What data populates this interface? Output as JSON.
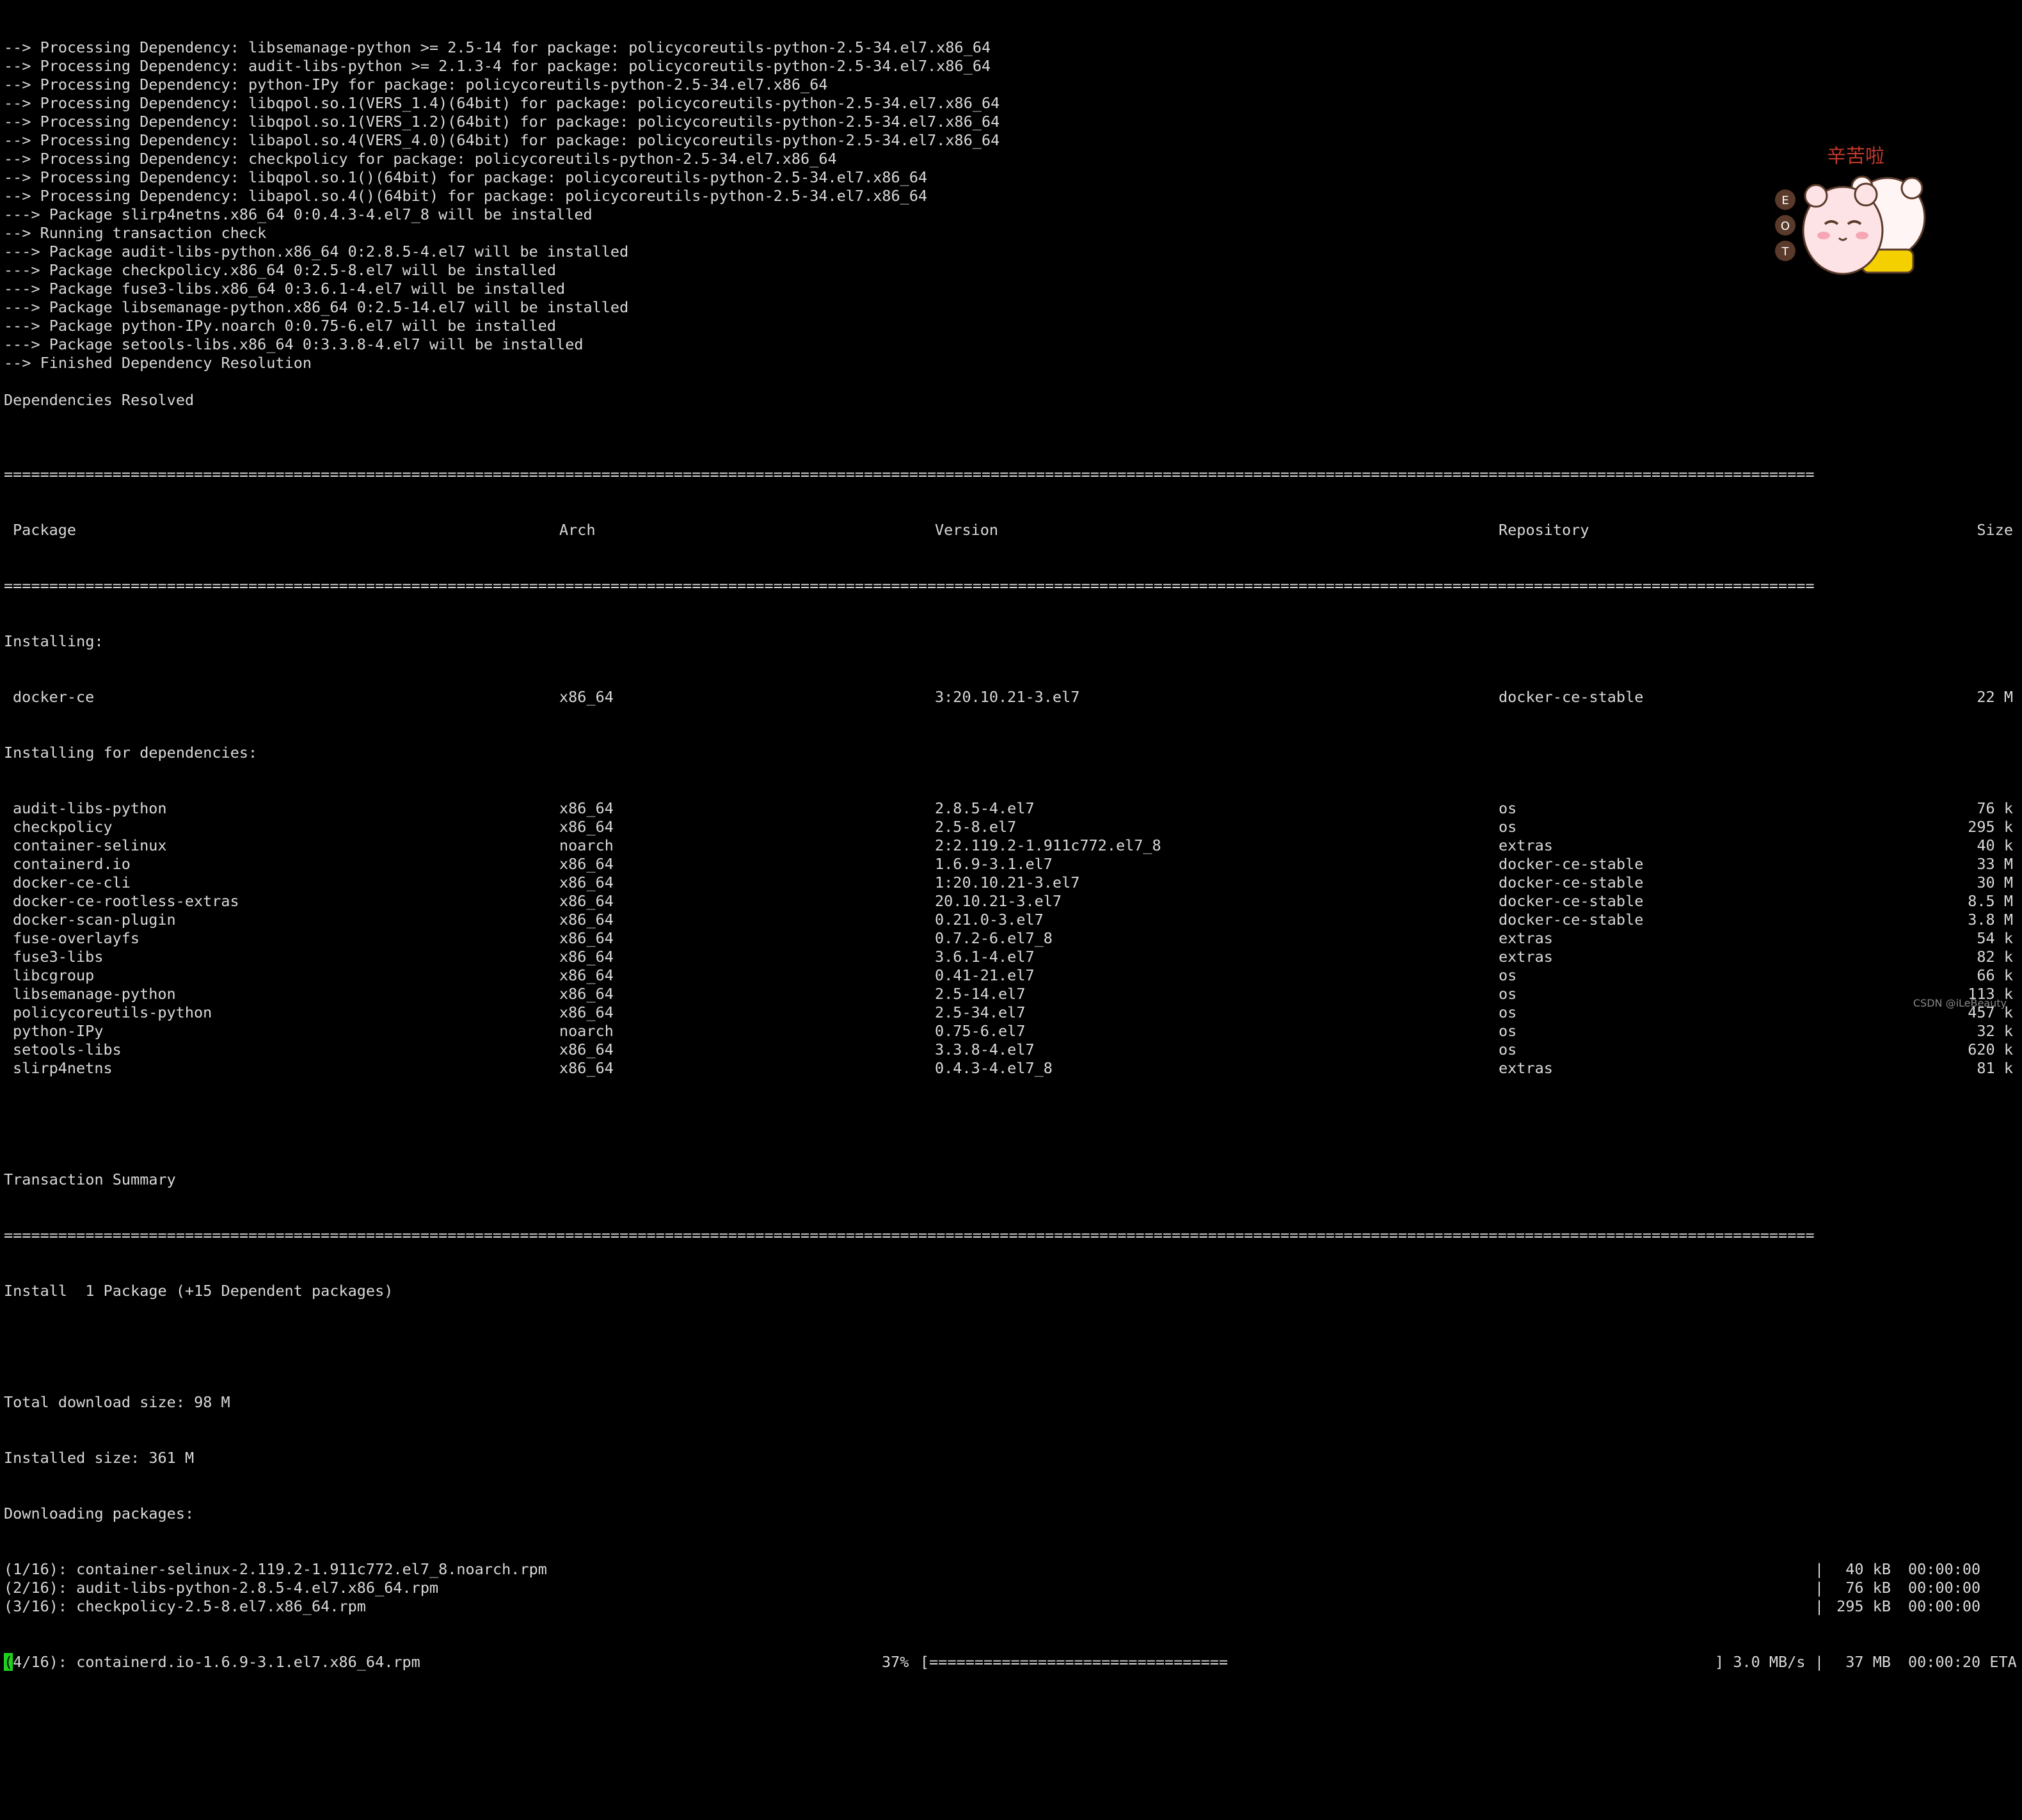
{
  "log_lines": [
    "--> Processing Dependency: libsemanage-python >= 2.5-14 for package: policycoreutils-python-2.5-34.el7.x86_64",
    "--> Processing Dependency: audit-libs-python >= 2.1.3-4 for package: policycoreutils-python-2.5-34.el7.x86_64",
    "--> Processing Dependency: python-IPy for package: policycoreutils-python-2.5-34.el7.x86_64",
    "--> Processing Dependency: libqpol.so.1(VERS_1.4)(64bit) for package: policycoreutils-python-2.5-34.el7.x86_64",
    "--> Processing Dependency: libqpol.so.1(VERS_1.2)(64bit) for package: policycoreutils-python-2.5-34.el7.x86_64",
    "--> Processing Dependency: libapol.so.4(VERS_4.0)(64bit) for package: policycoreutils-python-2.5-34.el7.x86_64",
    "--> Processing Dependency: checkpolicy for package: policycoreutils-python-2.5-34.el7.x86_64",
    "--> Processing Dependency: libqpol.so.1()(64bit) for package: policycoreutils-python-2.5-34.el7.x86_64",
    "--> Processing Dependency: libapol.so.4()(64bit) for package: policycoreutils-python-2.5-34.el7.x86_64",
    "---> Package slirp4netns.x86_64 0:0.4.3-4.el7_8 will be installed",
    "--> Running transaction check",
    "---> Package audit-libs-python.x86_64 0:2.8.5-4.el7 will be installed",
    "---> Package checkpolicy.x86_64 0:2.5-8.el7 will be installed",
    "---> Package fuse3-libs.x86_64 0:3.6.1-4.el7 will be installed",
    "---> Package libsemanage-python.x86_64 0:2.5-14.el7 will be installed",
    "---> Package python-IPy.noarch 0:0.75-6.el7 will be installed",
    "---> Package setools-libs.x86_64 0:3.3.8-4.el7 will be installed",
    "--> Finished Dependency Resolution",
    "",
    "Dependencies Resolved",
    ""
  ],
  "rule_char": "=",
  "table": {
    "headers": {
      "package": "Package",
      "arch": "Arch",
      "version": "Version",
      "repository": "Repository",
      "size": "Size"
    },
    "installing_label": "Installing:",
    "installing": [
      {
        "package": "docker-ce",
        "arch": "x86_64",
        "version": "3:20.10.21-3.el7",
        "repository": "docker-ce-stable",
        "size": "22 M"
      }
    ],
    "deps_label": "Installing for dependencies:",
    "deps": [
      {
        "package": "audit-libs-python",
        "arch": "x86_64",
        "version": "2.8.5-4.el7",
        "repository": "os",
        "size": "76 k"
      },
      {
        "package": "checkpolicy",
        "arch": "x86_64",
        "version": "2.5-8.el7",
        "repository": "os",
        "size": "295 k"
      },
      {
        "package": "container-selinux",
        "arch": "noarch",
        "version": "2:2.119.2-1.911c772.el7_8",
        "repository": "extras",
        "size": "40 k"
      },
      {
        "package": "containerd.io",
        "arch": "x86_64",
        "version": "1.6.9-3.1.el7",
        "repository": "docker-ce-stable",
        "size": "33 M"
      },
      {
        "package": "docker-ce-cli",
        "arch": "x86_64",
        "version": "1:20.10.21-3.el7",
        "repository": "docker-ce-stable",
        "size": "30 M"
      },
      {
        "package": "docker-ce-rootless-extras",
        "arch": "x86_64",
        "version": "20.10.21-3.el7",
        "repository": "docker-ce-stable",
        "size": "8.5 M"
      },
      {
        "package": "docker-scan-plugin",
        "arch": "x86_64",
        "version": "0.21.0-3.el7",
        "repository": "docker-ce-stable",
        "size": "3.8 M"
      },
      {
        "package": "fuse-overlayfs",
        "arch": "x86_64",
        "version": "0.7.2-6.el7_8",
        "repository": "extras",
        "size": "54 k"
      },
      {
        "package": "fuse3-libs",
        "arch": "x86_64",
        "version": "3.6.1-4.el7",
        "repository": "extras",
        "size": "82 k"
      },
      {
        "package": "libcgroup",
        "arch": "x86_64",
        "version": "0.41-21.el7",
        "repository": "os",
        "size": "66 k"
      },
      {
        "package": "libsemanage-python",
        "arch": "x86_64",
        "version": "2.5-14.el7",
        "repository": "os",
        "size": "113 k"
      },
      {
        "package": "policycoreutils-python",
        "arch": "x86_64",
        "version": "2.5-34.el7",
        "repository": "os",
        "size": "457 k"
      },
      {
        "package": "python-IPy",
        "arch": "noarch",
        "version": "0.75-6.el7",
        "repository": "os",
        "size": "32 k"
      },
      {
        "package": "setools-libs",
        "arch": "x86_64",
        "version": "3.3.8-4.el7",
        "repository": "os",
        "size": "620 k"
      },
      {
        "package": "slirp4netns",
        "arch": "x86_64",
        "version": "0.4.3-4.el7_8",
        "repository": "extras",
        "size": "81 k"
      }
    ]
  },
  "summary": {
    "title": "Transaction Summary",
    "install_line": "Install  1 Package (+15 Dependent packages)",
    "total_download": "Total download size: 98 M",
    "installed_size": "Installed size: 361 M",
    "downloading": "Downloading packages:"
  },
  "downloads": [
    {
      "file": "(1/16): container-selinux-2.119.2-1.911c772.el7_8.noarch.rpm",
      "size": "40 kB",
      "time": "00:00:00"
    },
    {
      "file": "(2/16): audit-libs-python-2.8.5-4.el7.x86_64.rpm",
      "size": "76 kB",
      "time": "00:00:00"
    },
    {
      "file": "(3/16): checkpolicy-2.5-8.el7.x86_64.rpm",
      "size": "295 kB",
      "time": "00:00:00"
    }
  ],
  "progress": {
    "cursor_char": "(",
    "file_rest": "4/16): containerd.io-1.6.9-3.1.el7.x86_64.rpm",
    "percent_text": "37%",
    "percent": 37,
    "bar_open": "[",
    "bar_fill": "=================================",
    "bar_close": "]",
    "rate": "3.0 MB/s",
    "size": "37 MB",
    "eta": "00:00:20 ETA"
  },
  "sticker": {
    "text": "辛苦啦",
    "side_letters": [
      "E",
      "O",
      "T"
    ]
  },
  "watermark": "CSDN @iLeBeauty",
  "colors": {
    "background": "#000000",
    "foreground": "#d9d9d9",
    "cursor": "#1fd11f",
    "sticker_text": "#c0392b"
  }
}
